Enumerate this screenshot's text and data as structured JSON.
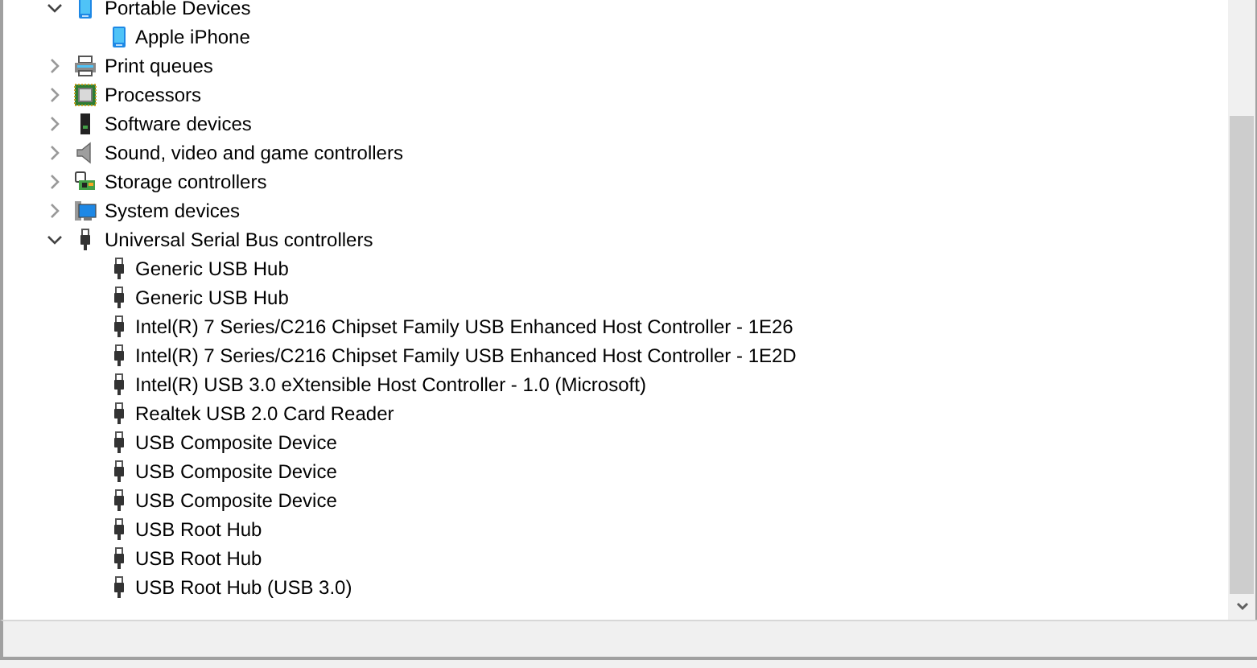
{
  "tree": [
    {
      "label": "Portable Devices",
      "kind": "portable",
      "expanded": true,
      "children": [
        {
          "label": "Apple iPhone",
          "kind": "portable"
        }
      ]
    },
    {
      "label": "Print queues",
      "kind": "printer",
      "expanded": false
    },
    {
      "label": "Processors",
      "kind": "processor",
      "expanded": false
    },
    {
      "label": "Software devices",
      "kind": "software",
      "expanded": false
    },
    {
      "label": "Sound, video and game controllers",
      "kind": "sound",
      "expanded": false
    },
    {
      "label": "Storage controllers",
      "kind": "storage",
      "expanded": false
    },
    {
      "label": "System devices",
      "kind": "system",
      "expanded": false
    },
    {
      "label": "Universal Serial Bus controllers",
      "kind": "usb",
      "expanded": true,
      "children": [
        {
          "label": "Generic USB Hub",
          "kind": "usb"
        },
        {
          "label": "Generic USB Hub",
          "kind": "usb"
        },
        {
          "label": "Intel(R) 7 Series/C216 Chipset Family USB Enhanced Host Controller - 1E26",
          "kind": "usb"
        },
        {
          "label": "Intel(R) 7 Series/C216 Chipset Family USB Enhanced Host Controller - 1E2D",
          "kind": "usb"
        },
        {
          "label": "Intel(R) USB 3.0 eXtensible Host Controller - 1.0 (Microsoft)",
          "kind": "usb"
        },
        {
          "label": "Realtek USB 2.0 Card Reader",
          "kind": "usb"
        },
        {
          "label": "USB Composite Device",
          "kind": "usb"
        },
        {
          "label": "USB Composite Device",
          "kind": "usb"
        },
        {
          "label": "USB Composite Device",
          "kind": "usb"
        },
        {
          "label": "USB Root Hub",
          "kind": "usb"
        },
        {
          "label": "USB Root Hub",
          "kind": "usb"
        },
        {
          "label": "USB Root Hub (USB 3.0)",
          "kind": "usb"
        }
      ]
    }
  ]
}
